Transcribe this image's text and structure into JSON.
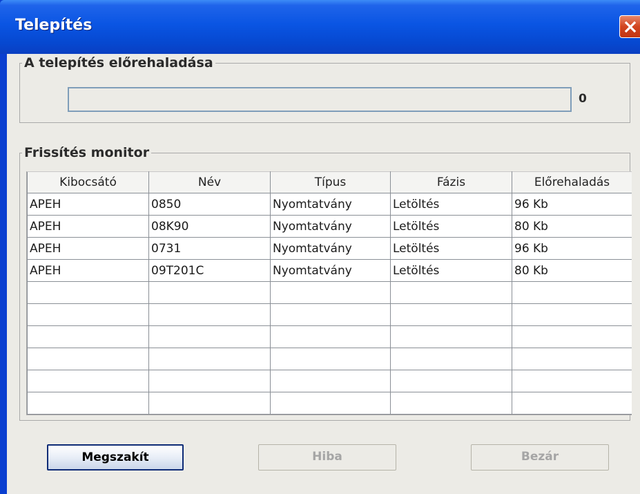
{
  "window": {
    "title": "Telepítés"
  },
  "progress_group": {
    "title": "A telepítés előrehaladása",
    "value_text": "0",
    "fraction": 0
  },
  "monitor_group": {
    "title": "Frissítés monitor",
    "columns": [
      "Kibocsátó",
      "Név",
      "Típus",
      "Fázis",
      "Előrehaladás"
    ],
    "rows": [
      [
        "APEH",
        "0850",
        "Nyomtatvány",
        "Letöltés",
        "96 Kb"
      ],
      [
        "APEH",
        "08K90",
        "Nyomtatvány",
        "Letöltés",
        "80 Kb"
      ],
      [
        "APEH",
        "0731",
        "Nyomtatvány",
        "Letöltés",
        "96 Kb"
      ],
      [
        "APEH",
        "09T201C",
        "Nyomtatvány",
        "Letöltés",
        "80 Kb"
      ],
      [
        "",
        "",
        "",
        "",
        ""
      ],
      [
        "",
        "",
        "",
        "",
        ""
      ],
      [
        "",
        "",
        "",
        "",
        ""
      ],
      [
        "",
        "",
        "",
        "",
        ""
      ],
      [
        "",
        "",
        "",
        "",
        ""
      ],
      [
        "",
        "",
        "",
        "",
        ""
      ]
    ]
  },
  "buttons": {
    "abort": "Megszakít",
    "error": "Hiba",
    "close": "Bezár"
  },
  "icons": {
    "close": "close-icon"
  },
  "colors": {
    "titlebar": "#0a55e3",
    "close_button": "#d2451f",
    "dialog_bg": "#ecebe6"
  }
}
